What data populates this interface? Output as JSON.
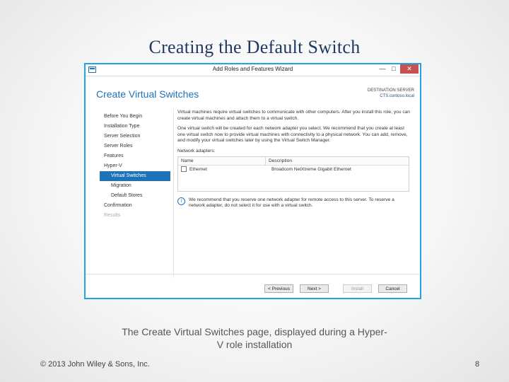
{
  "slide": {
    "title": "Creating the Default Switch",
    "caption_line1": "The Create Virtual Switches page, displayed during a Hyper-",
    "caption_line2": "V role installation",
    "footer": "© 2013 John Wiley & Sons, Inc.",
    "page_number": "8"
  },
  "window": {
    "title": "Add Roles and Features Wizard",
    "controls": {
      "minimize": "—",
      "maximize": "□",
      "close": "✕"
    },
    "heading": "Create Virtual Switches",
    "destination_label": "DESTINATION SERVER",
    "destination_server": "CTS.contoso.local"
  },
  "nav": {
    "items": [
      {
        "label": "Before You Begin",
        "state": "normal",
        "sub": false
      },
      {
        "label": "Installation Type",
        "state": "normal",
        "sub": false
      },
      {
        "label": "Server Selection",
        "state": "normal",
        "sub": false
      },
      {
        "label": "Server Roles",
        "state": "normal",
        "sub": false
      },
      {
        "label": "Features",
        "state": "normal",
        "sub": false
      },
      {
        "label": "Hyper-V",
        "state": "normal",
        "sub": false
      },
      {
        "label": "Virtual Switches",
        "state": "active",
        "sub": true
      },
      {
        "label": "Migration",
        "state": "normal",
        "sub": true
      },
      {
        "label": "Default Stores",
        "state": "normal",
        "sub": true
      },
      {
        "label": "Confirmation",
        "state": "normal",
        "sub": false
      },
      {
        "label": "Results",
        "state": "disabled",
        "sub": false
      }
    ]
  },
  "content": {
    "para1": "Virtual machines require virtual switches to communicate with other computers. After you install this role, you can create virtual machines and attach them to a virtual switch.",
    "para2": "One virtual switch will be created for each network adapter you select. We recommend that you create at least one virtual switch now to provide virtual machines with connectivity to a physical network. You can add, remove, and modify your virtual switches later by using the Virtual Switch Manager.",
    "adapters_label": "Network adapters:",
    "columns": {
      "name": "Name",
      "description": "Description"
    },
    "adapters": [
      {
        "name": "Ethernet",
        "description": "Broadcom NetXtreme Gigabit Ethernet",
        "checked": false
      }
    ],
    "info_note": "We recommend that you reserve one network adapter for remote access to this server. To reserve a network adapter, do not select it for use with a virtual switch."
  },
  "buttons": {
    "previous": "< Previous",
    "next": "Next >",
    "install": "Install",
    "cancel": "Cancel"
  },
  "colors": {
    "window_border": "#1ea5e5",
    "accent": "#1e72b8",
    "title_text": "#1f3864",
    "close_button": "#c75050"
  }
}
